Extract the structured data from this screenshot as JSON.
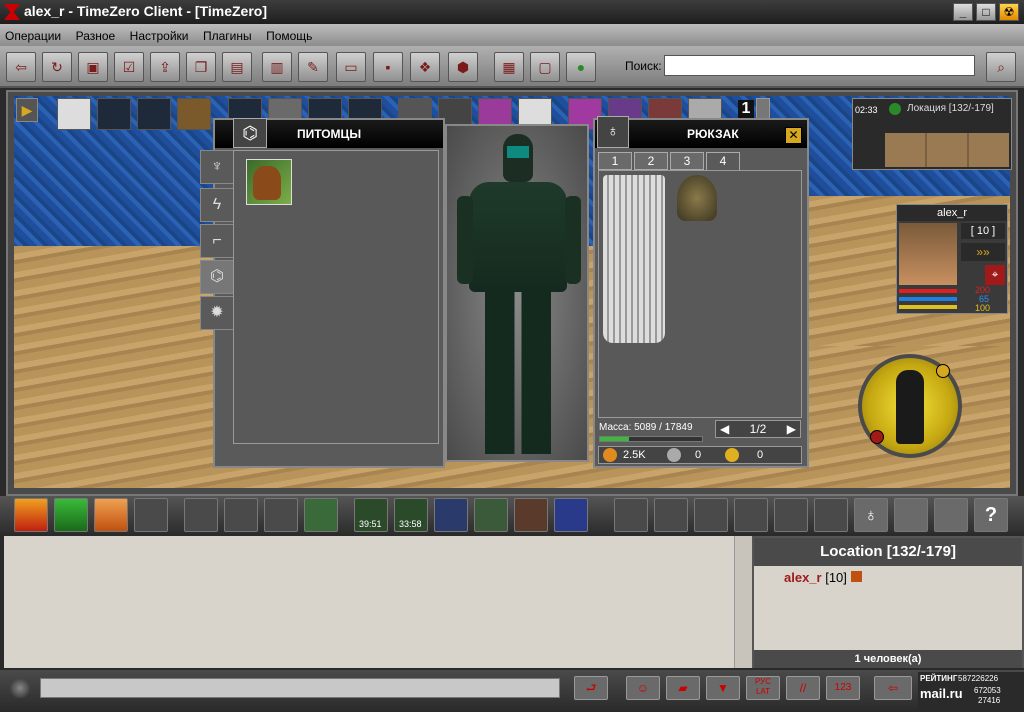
{
  "window": {
    "title": "alex_r - TimeZero Client - [TimeZero]",
    "controls": [
      "_",
      "□",
      "☢"
    ]
  },
  "menu": [
    "Операции",
    "Разное",
    "Настройки",
    "Плагины",
    "Помощь"
  ],
  "toolbar": {
    "search_label": "Поиск:",
    "search_value": ""
  },
  "pets": {
    "title": "ПИТОМЦЫ",
    "tabs": [
      "♆",
      "ϟ",
      "⌐",
      "⌬",
      "✹"
    ]
  },
  "backpack": {
    "title": "РЮКЗАК",
    "close": "✕",
    "tabs": [
      "1",
      "2",
      "3",
      "4"
    ],
    "active_tab": "4",
    "mass_label": "Масса: 5089 / 17849",
    "mass_fraction": 0.285,
    "page": "1/2",
    "money": [
      "2.5K",
      "0",
      "0"
    ]
  },
  "location_mini": {
    "time": "02:33",
    "label": "Локация [132/-179]"
  },
  "char_card": {
    "name": "alex_r",
    "level": "[ 10 ]",
    "hp": "200",
    "mp": "65",
    "stamina": "100"
  },
  "slots": {
    "counter": "1"
  },
  "action_timers": [
    "39:51",
    "33:58"
  ],
  "who": {
    "title": "Location [132/-179]",
    "user_name": "alex_r",
    "user_level": "[10]",
    "footer": "1 человек(а)"
  },
  "rating": {
    "label": "РЕЙТИНГ",
    "value": "587226226",
    "brand": "mail.ru",
    "num1": "672053",
    "num2": "27416"
  },
  "colors": {
    "accent": "#d6a820",
    "hp": "#e02020",
    "mp": "#2080e0",
    "stamina": "#e0c020"
  }
}
